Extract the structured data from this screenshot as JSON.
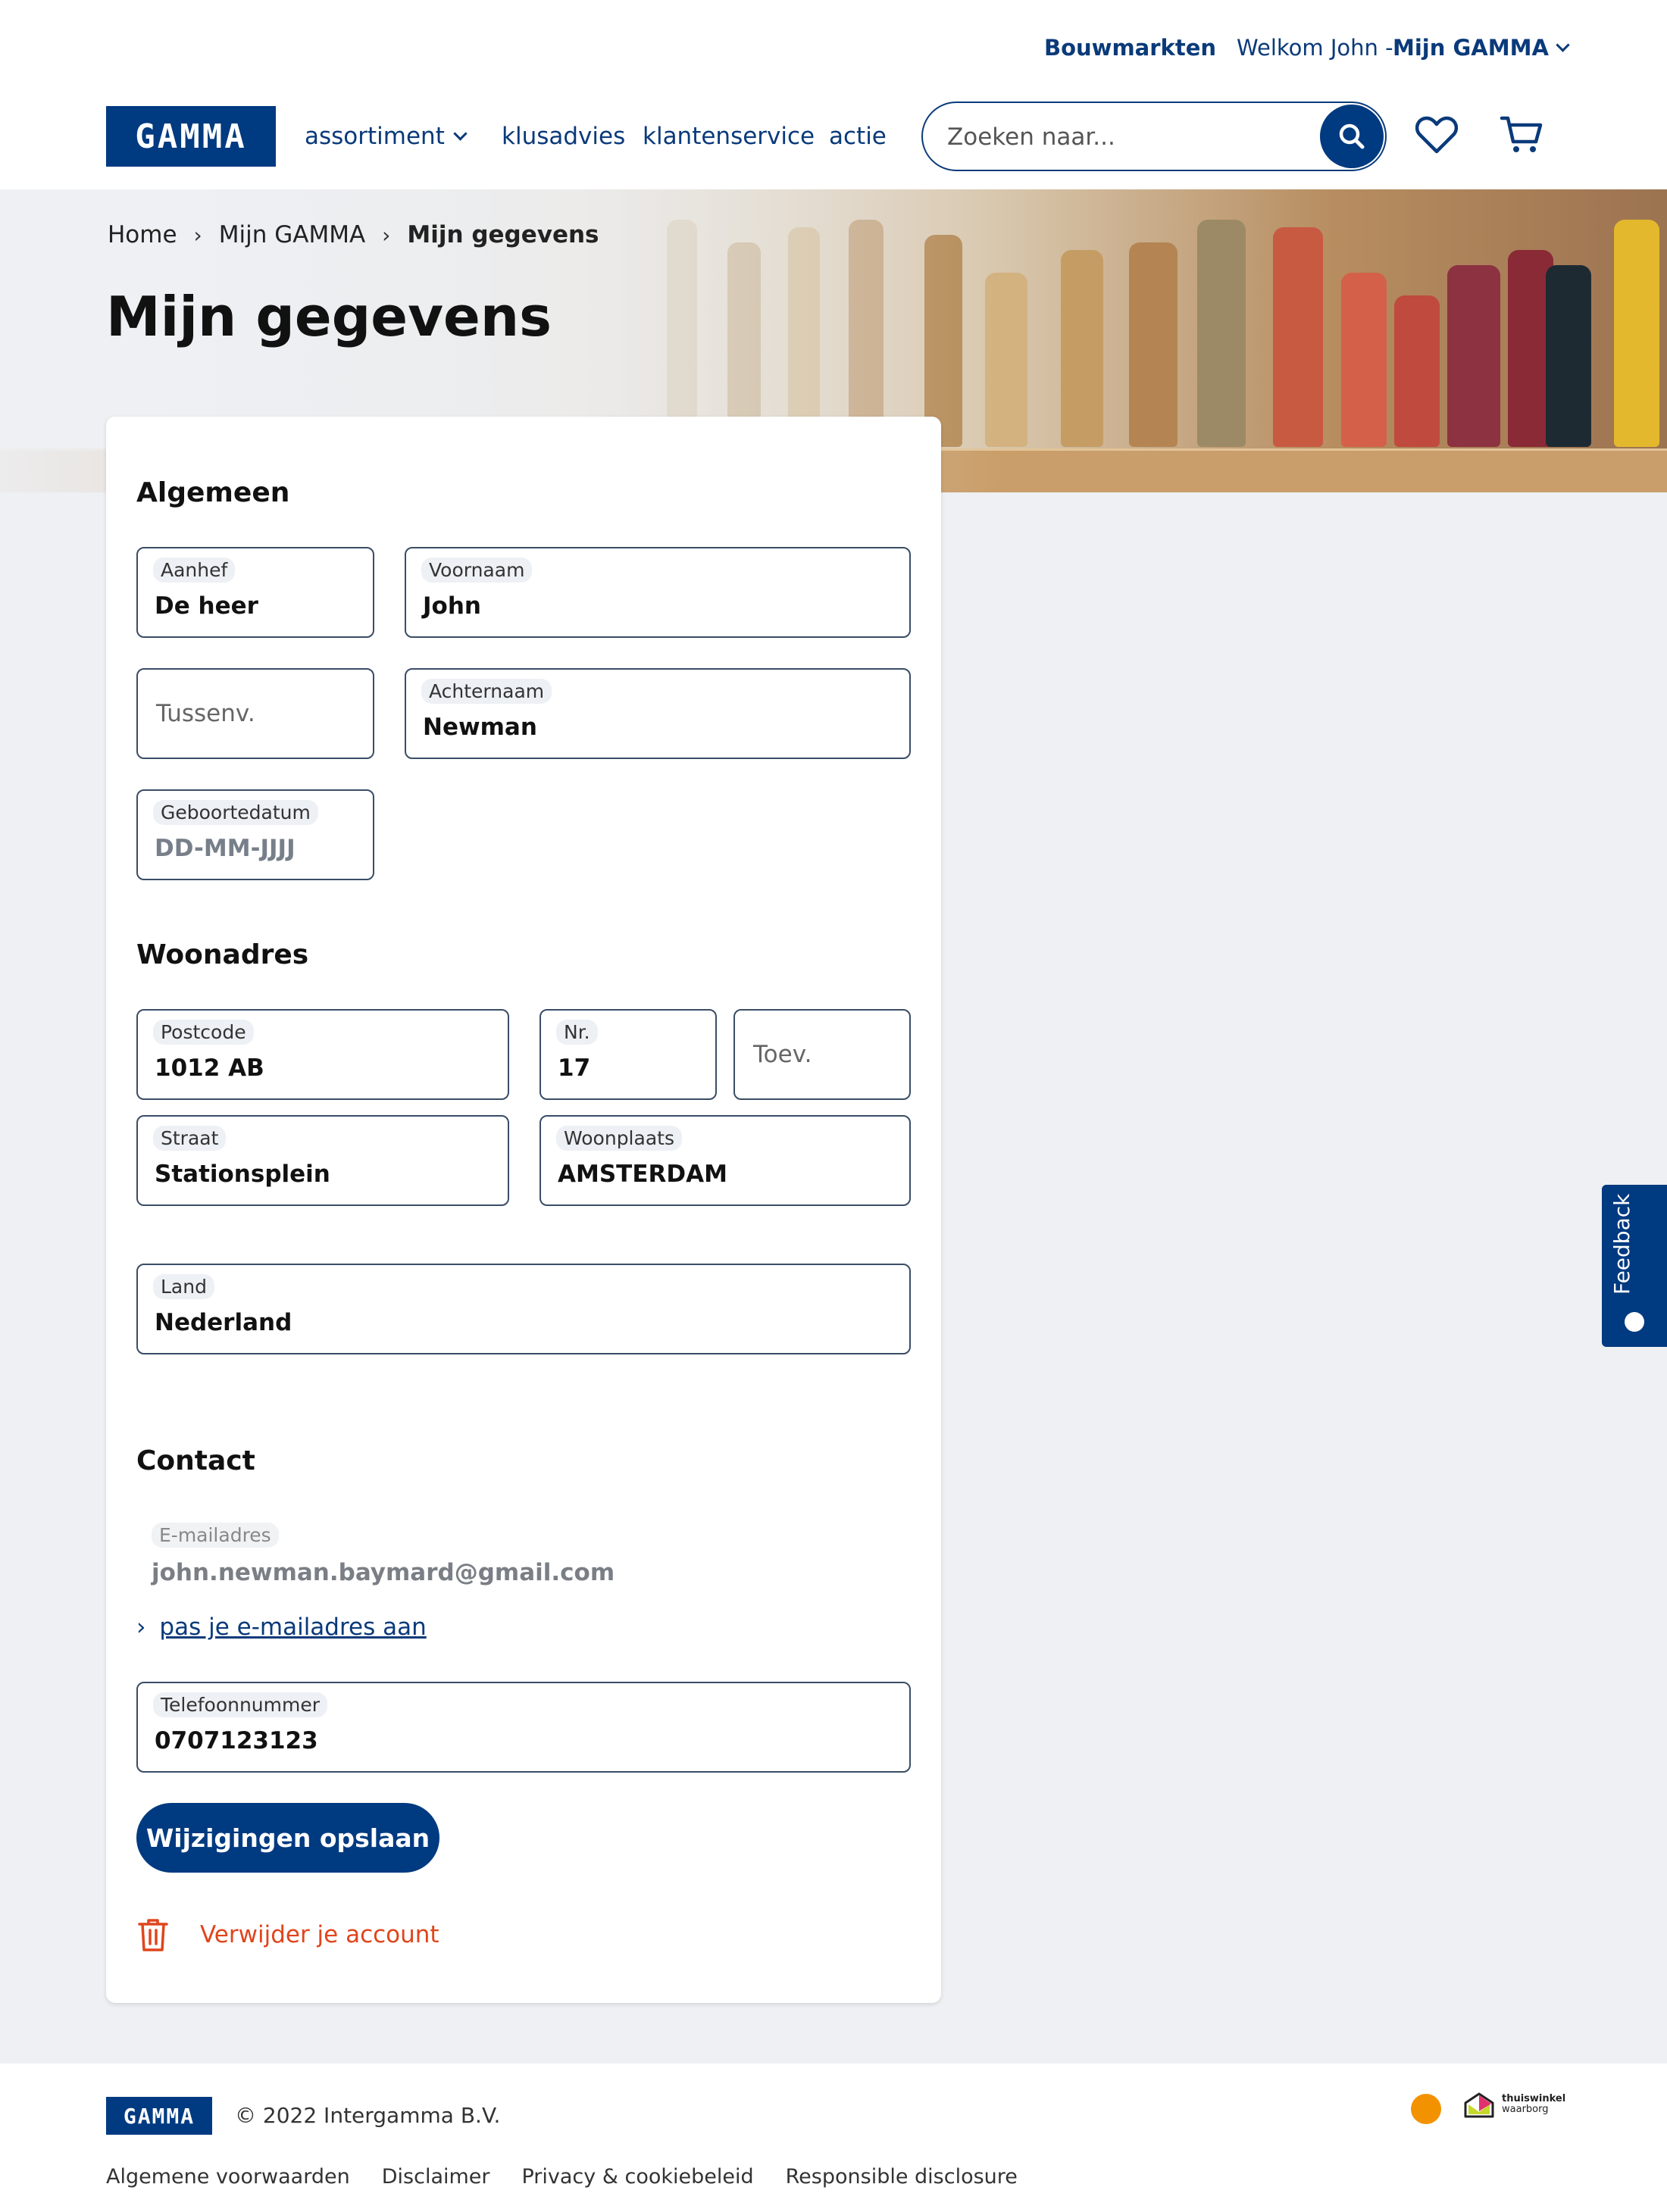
{
  "topbar": {
    "stores": "Bouwmarkten",
    "welcome": "Welkom John -",
    "account": "Mijn GAMMA"
  },
  "brand": {
    "logo_text": "GAMMA",
    "color": "#003a80"
  },
  "nav": {
    "items": [
      {
        "label": "assortiment",
        "dropdown": true
      },
      {
        "label": "klusadvies"
      },
      {
        "label": "klantenservice"
      },
      {
        "label": "actie"
      }
    ]
  },
  "search": {
    "placeholder": "Zoeken naar..."
  },
  "breadcrumb": [
    "Home",
    "Mijn GAMMA",
    "Mijn gegevens"
  ],
  "page": {
    "title": "Mijn gegevens"
  },
  "sections": {
    "general": "Algemeen",
    "address": "Woonadres",
    "contact": "Contact"
  },
  "fields": {
    "salutation": {
      "label": "Aanhef",
      "value": "De heer"
    },
    "first_name": {
      "label": "Voornaam",
      "value": "John"
    },
    "infix": {
      "placeholder": "Tussenv."
    },
    "last_name": {
      "label": "Achternaam",
      "value": "Newman"
    },
    "birthdate": {
      "label": "Geboortedatum",
      "value": "DD-MM-JJJJ"
    },
    "postcode": {
      "label": "Postcode",
      "value": "1012 AB"
    },
    "number": {
      "label": "Nr.",
      "value": "17"
    },
    "addition": {
      "placeholder": "Toev."
    },
    "street": {
      "label": "Straat",
      "value": "Stationsplein"
    },
    "city": {
      "label": "Woonplaats",
      "value": "AMSTERDAM"
    },
    "country": {
      "label": "Land",
      "value": "Nederland"
    },
    "email": {
      "label": "E-mailadres",
      "value": "john.newman.baymard@gmail.com"
    },
    "phone": {
      "label": "Telefoonnummer",
      "value": "0707123123"
    }
  },
  "actions": {
    "change_email": "pas je e-mailadres aan",
    "save": "Wijzigingen opslaan",
    "delete_account": "Verwijder je account"
  },
  "feedback": {
    "label": "Feedback"
  },
  "footer": {
    "logo_text": "GAMMA",
    "copyright": "© 2022 Intergamma B.V.",
    "links": [
      "Algemene voorwaarden",
      "Disclaimer",
      "Privacy & cookiebeleid",
      "Responsible disclosure"
    ],
    "badge_text_1": "thuiswinkel",
    "badge_text_2": "waarborg"
  },
  "colors": {
    "primary": "#003a80",
    "danger": "#e0451c",
    "background": "#eef0f4"
  }
}
